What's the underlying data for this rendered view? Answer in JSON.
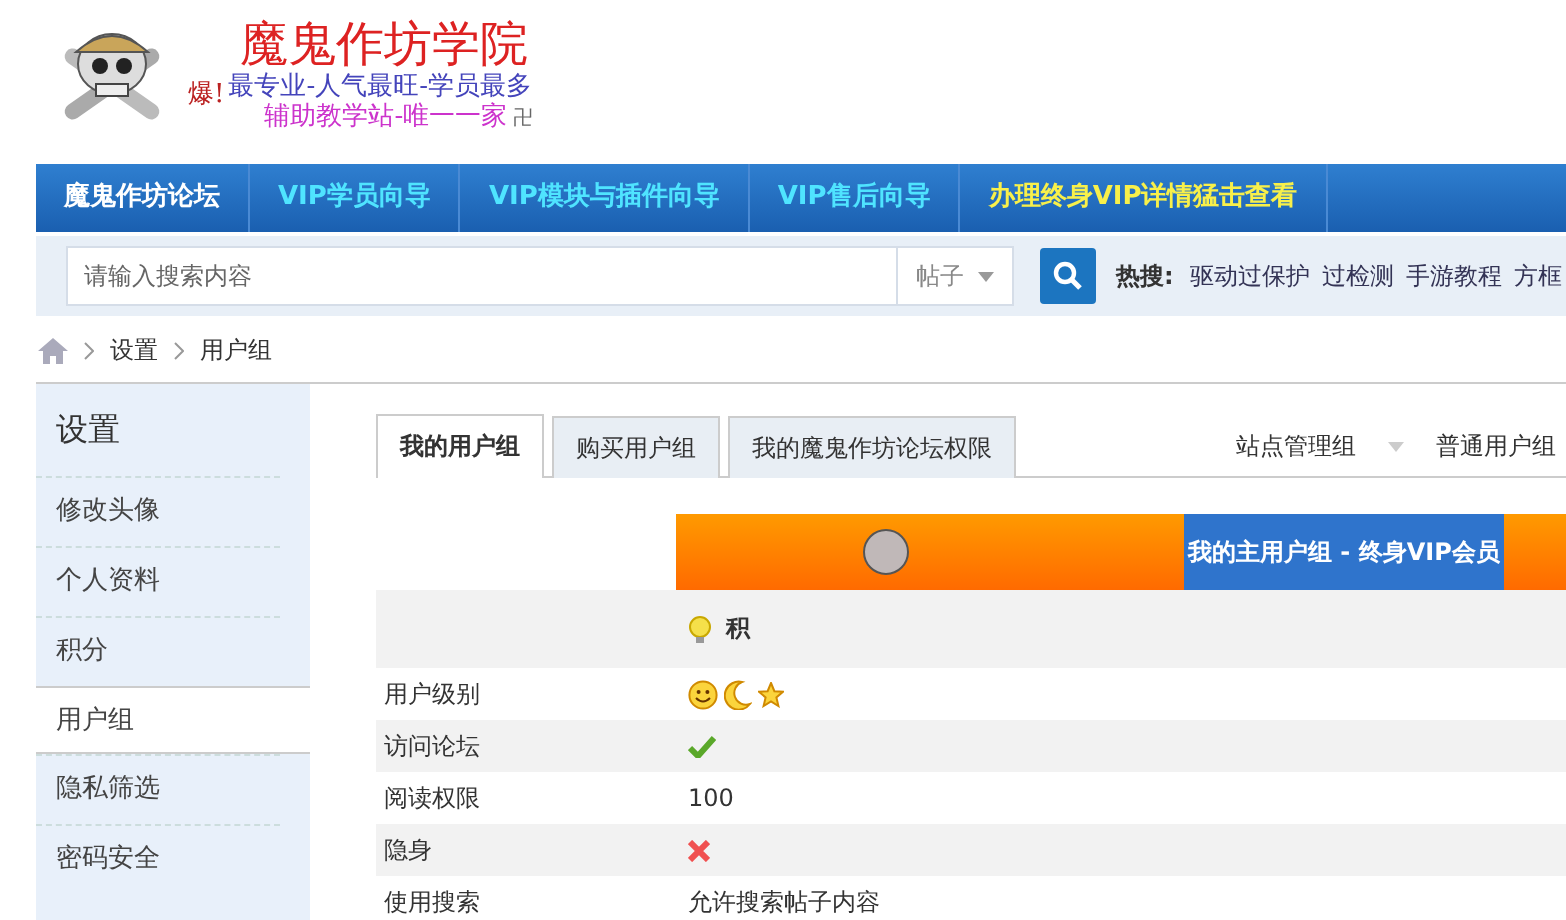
{
  "logo": {
    "exclaim": "爆!",
    "title": "魔鬼作坊学院",
    "slogan_1": "最专业-人气最旺-学员最多",
    "slogan_2": "辅助教学站-唯一一家",
    "mark": "卍"
  },
  "nav": [
    {
      "label": "魔鬼作坊论坛",
      "kind": "home"
    },
    {
      "label": "VIP学员向导",
      "kind": "normal"
    },
    {
      "label": "VIP模块与插件向导",
      "kind": "normal"
    },
    {
      "label": "VIP售后向导",
      "kind": "normal"
    },
    {
      "label": "办理终身VIP详情猛击查看",
      "kind": "highlight"
    }
  ],
  "search": {
    "placeholder": "请输入搜索内容",
    "type": "帖子",
    "hot_label": "热搜:",
    "hot": [
      "驱动过保护",
      "过检测",
      "手游教程",
      "方框"
    ]
  },
  "breadcrumb": [
    "设置",
    "用户组"
  ],
  "sidebar": {
    "title": "设置",
    "items": [
      {
        "label": "修改头像",
        "selected": false
      },
      {
        "label": "个人资料",
        "selected": false
      },
      {
        "label": "积分",
        "selected": false
      },
      {
        "label": "用户组",
        "selected": true
      },
      {
        "label": "隐私筛选",
        "selected": false
      },
      {
        "label": "密码安全",
        "selected": false
      }
    ]
  },
  "tabs": [
    {
      "label": "我的用户组",
      "selected": true
    },
    {
      "label": "购买用户组",
      "selected": false
    },
    {
      "label": "我的魔鬼作坊论坛权限",
      "selected": false
    }
  ],
  "group_links": [
    "站点管理组",
    "普通用户组"
  ],
  "banner": {
    "title": "我的主用户组 - 终身VIP会员"
  },
  "table": {
    "header": "积",
    "rows": [
      {
        "label": "用户级别",
        "kind": "icons"
      },
      {
        "label": "访问论坛",
        "kind": "bool",
        "allowed": true
      },
      {
        "label": "阅读权限",
        "kind": "text",
        "value": "100"
      },
      {
        "label": "隐身",
        "kind": "bool",
        "allowed": false
      },
      {
        "label": "使用搜索",
        "kind": "text",
        "value": "允许搜索帖子内容"
      }
    ]
  }
}
